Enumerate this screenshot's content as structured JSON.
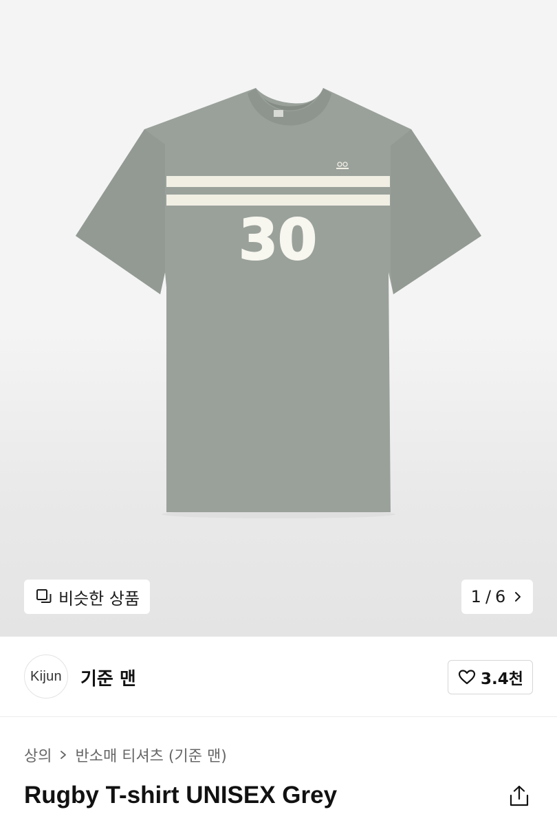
{
  "gallery": {
    "image_print_number": "30",
    "similar_products_label": "비슷한 상품",
    "similar_icon": "stacked-squares-icon",
    "page_current": "1",
    "page_separator": "/",
    "page_total": "6",
    "next_icon": "chevron-right-icon"
  },
  "brand": {
    "logo_text": "Kijun",
    "name": "기준 맨",
    "like_icon": "heart-outline-icon",
    "like_count": "3.4천"
  },
  "breadcrumb": {
    "category": "상의",
    "separator_icon": "chevron-right-icon",
    "subcategory": "반소매 티셔츠 (기준 맨)"
  },
  "product": {
    "title": "Rugby T-shirt UNISEX Grey",
    "share_icon": "share-icon"
  },
  "colors": {
    "shirt": "#9aa19b",
    "stripe": "#f1efe4",
    "text_primary": "#111111",
    "text_secondary": "#666666"
  }
}
